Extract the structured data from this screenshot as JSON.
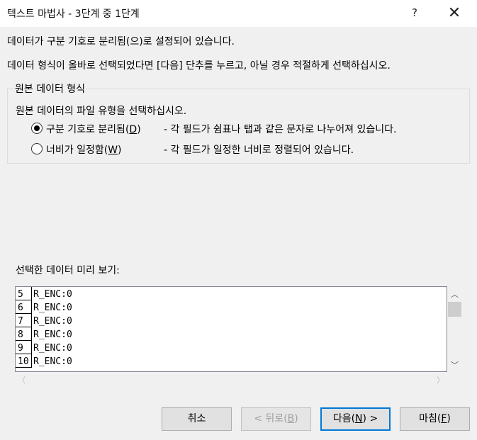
{
  "window": {
    "title": "텍스트 마법사 - 3단계 중 1단계",
    "help_glyph": "?",
    "close_glyph": "✕"
  },
  "intro": {
    "line1": "데이터가 구분 기호로 분리됨(으)로 설정되어 있습니다.",
    "line2": "데이터 형식이 올바로 선택되었다면 [다음] 단추를 누르고, 아닐 경우 적절하게 선택하십시오."
  },
  "source_format": {
    "group_title": "원본 데이터 형식",
    "description": "원본 데이터의 파일 유형을 선택하십시오.",
    "options": [
      {
        "label_pre": "구분 기호로 분리됨(",
        "accel": "D",
        "label_post": ")",
        "desc": "- 각 필드가 쉼표나 탭과 같은 문자로 나누어져 있습니다.",
        "selected": true
      },
      {
        "label_pre": "너비가 일정함(",
        "accel": "W",
        "label_post": ")",
        "desc": "- 각 필드가 일정한 너비로 정렬되어 있습니다.",
        "selected": false
      }
    ]
  },
  "preview": {
    "label": "선택한 데이터 미리 보기:",
    "rows": [
      {
        "num": "5",
        "value": "R_ENC:0"
      },
      {
        "num": "6",
        "value": "R_ENC:0"
      },
      {
        "num": "7",
        "value": "R_ENC:0"
      },
      {
        "num": "8",
        "value": "R_ENC:0"
      },
      {
        "num": "9",
        "value": "R_ENC:0"
      },
      {
        "num": "10",
        "value": "R_ENC:0"
      }
    ],
    "scroll_up_glyph": "︿",
    "scroll_down_glyph": "﹀",
    "scroll_left_glyph": "〈",
    "scroll_right_glyph": "〉"
  },
  "buttons": {
    "cancel": "취소",
    "back_pre": "< 뒤로(",
    "back_accel": "B",
    "back_post": ")",
    "next_pre": "다음(",
    "next_accel": "N",
    "next_post": ") >",
    "finish_pre": "마침(",
    "finish_accel": "F",
    "finish_post": ")"
  }
}
